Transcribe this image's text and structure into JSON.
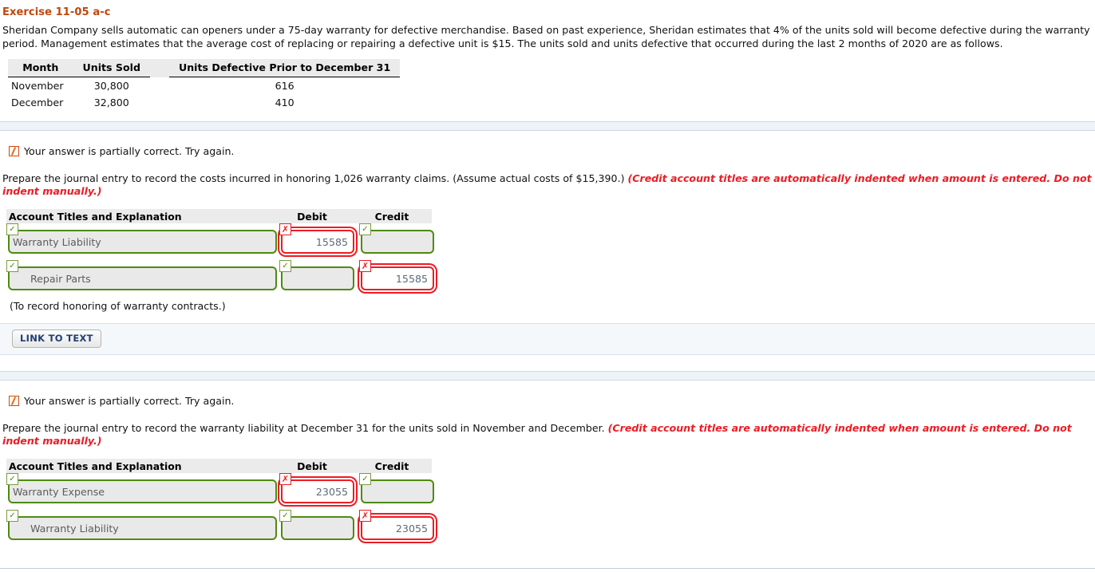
{
  "exercise": {
    "title": "Exercise 11-05 a-c",
    "paragraph": "Sheridan Company sells automatic can openers under a 75-day warranty for defective merchandise. Based on past experience, Sheridan estimates that 4% of the units sold will become defective during the warranty period. Management estimates that the average cost of replacing or repairing a defective unit is $15. The units sold and units defective that occurred during the last 2 months of 2020 are as follows."
  },
  "data_table": {
    "headers": [
      "Month",
      "Units Sold",
      "Units Defective Prior to December 31"
    ],
    "rows": [
      [
        "November",
        "30,800",
        "616"
      ],
      [
        "December",
        "32,800",
        "410"
      ]
    ]
  },
  "part_b": {
    "feedback": "Your answer is partially correct.  Try again.",
    "feedback_icon": "partial-correct-icon",
    "instruction_plain": "Prepare the journal entry to record the costs incurred in honoring 1,026 warranty claims. (Assume actual costs of $15,390.) ",
    "instruction_emphasis": "(Credit account titles are automatically indented when amount is entered. Do not indent manually.)",
    "journal": {
      "headers": [
        "Account Titles and Explanation",
        "Debit",
        "Credit"
      ],
      "rows": [
        {
          "account": "Warranty Liability",
          "account_status": "ok",
          "indent": false,
          "debit": "15585",
          "debit_status": "bad",
          "credit": "",
          "credit_status": "ok"
        },
        {
          "account": "Repair Parts",
          "account_status": "ok",
          "indent": true,
          "debit": "",
          "debit_status": "ok",
          "credit": "15585",
          "credit_status": "bad"
        }
      ],
      "note": "(To record honoring of warranty contracts.)"
    },
    "link_button": "LINK TO TEXT"
  },
  "part_c": {
    "feedback": "Your answer is partially correct.  Try again.",
    "feedback_icon": "partial-correct-icon",
    "instruction_plain": "Prepare the journal entry to record the warranty liability at December 31 for the units sold in November and December. ",
    "instruction_emphasis": "(Credit account titles are automatically indented when amount is entered. Do not indent manually.)",
    "journal": {
      "headers": [
        "Account Titles and Explanation",
        "Debit",
        "Credit"
      ],
      "rows": [
        {
          "account": "Warranty Expense",
          "account_status": "ok",
          "indent": false,
          "debit": "23055",
          "debit_status": "bad",
          "credit": "",
          "credit_status": "ok"
        },
        {
          "account": "Warranty Liability",
          "account_status": "ok",
          "indent": true,
          "debit": "",
          "debit_status": "ok",
          "credit": "23055",
          "credit_status": "bad"
        }
      ]
    }
  },
  "colors": {
    "title": "#c0450b",
    "emphasis_red": "#ec1c24",
    "correct_green": "#4f8a10",
    "incorrect_red": "#ec1c24",
    "partial_orange": "#d2490a"
  }
}
